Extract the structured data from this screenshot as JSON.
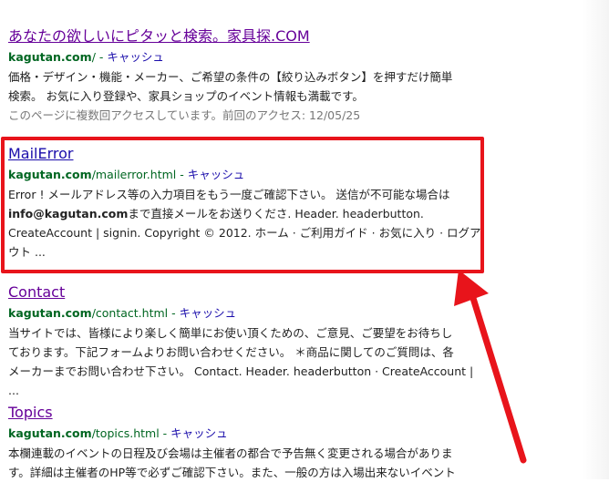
{
  "results": [
    {
      "title": "あなたの欲しいにピタッと検索。家具探.COM",
      "url_host": "kagutan.com",
      "url_path": "/",
      "separator": " - ",
      "cache_label": "キャッシュ",
      "snippet_lines": [
        "価格・デザイン・機能・メーカー、ご希望の条件の【絞り込みボタン】を押すだけ簡単",
        "検索。 お気に入り登録や、家具ショップのイベント情報も満載です。"
      ],
      "visit_note": "このページに複数回アクセスしています。前回のアクセス: 12/05/25"
    },
    {
      "title": "MailError",
      "url_host": "kagutan.com",
      "url_path": "/mailerror.html",
      "separator": " - ",
      "cache_label": "キャッシュ",
      "snippet_line1": "Error ! メールアドレス等の入力項目をもう一度ご確認下さい。 送信が不可能な場合は",
      "snippet_bold": "info@kagutan.com",
      "snippet_line2_rest": "まで直接メールをお送りくださ. Header. headerbutton.",
      "snippet_line3": "CreateAccount | signin. Copyright © 2012. ホーム · ご利用ガイド · お気に入り · ログア",
      "snippet_line4": "ウト ..."
    },
    {
      "title": "Contact",
      "url_host": "kagutan.com",
      "url_path": "/contact.html",
      "separator": " - ",
      "cache_label": "キャッシュ",
      "snippet_lines": [
        "当サイトでは、皆様により楽しく簡単にお使い頂くための、ご意見、ご要望をお待ちし",
        "ております。下記フォームよりお問い合わせください。 ＊商品に関してのご質問は、各",
        "メーカーまでお問い合わせ下さい。 Contact. Header. headerbutton · CreateAccount | ..."
      ]
    },
    {
      "title": "Topics",
      "url_host": "kagutan.com",
      "url_path": "/topics.html",
      "separator": " - ",
      "cache_label": "キャッシュ",
      "snippet_lines": [
        "本欄連載のイベントの日程及び会場は主催者の都合で予告無く変更される場合がありま",
        "す。詳細は主催者のHP等で必ずご確認下さい。また、一般の方は入場出来ないイベント"
      ]
    }
  ],
  "annotation": {
    "box_color": "#e8141b",
    "arrow_color": "#e8141b"
  }
}
